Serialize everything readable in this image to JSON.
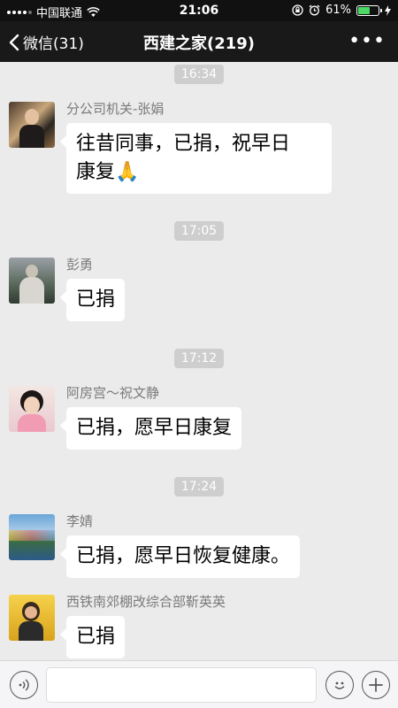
{
  "status_bar": {
    "carrier": "中国联通",
    "time": "21:06",
    "battery_percent": "61%",
    "battery_level": 0.61
  },
  "nav": {
    "back_label": "微信(31)",
    "title": "西建之家(219)",
    "more_label": "•••"
  },
  "messages": [
    {
      "timestamp": "16:34",
      "sender": "分公司机关-张娟",
      "text": "往昔同事，已捐，祝早日\n康复🙏"
    },
    {
      "timestamp": "17:05",
      "sender": "彭勇",
      "text": "已捐"
    },
    {
      "timestamp": "17:12",
      "sender": "阿房宫～祝文静",
      "text": "已捐，愿早日康复"
    },
    {
      "timestamp": "17:24",
      "sender": "李婧",
      "text": "已捐，愿早日恢复健康。"
    },
    {
      "timestamp": "",
      "sender": "西铁南郊棚改综合部靳英英",
      "text": "已捐"
    }
  ],
  "input_bar": {
    "voice_icon": "voice-icon",
    "emoji_icon": "emoji-icon",
    "plus_icon": "plus-icon",
    "placeholder": ""
  },
  "colors": {
    "chat_background": "#ebebeb",
    "nav_background": "#191919",
    "bubble": "#ffffff",
    "timestamp_bg": "#cecece",
    "battery_green": "#4cd964"
  }
}
